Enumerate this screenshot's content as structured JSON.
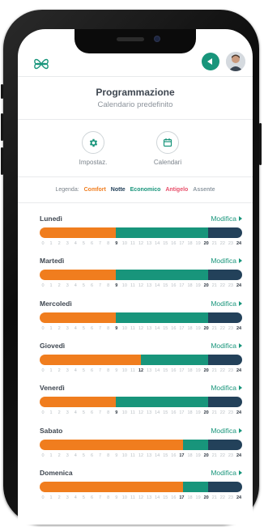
{
  "header": {
    "title": "Programmazione",
    "subtitle": "Calendario predefinito"
  },
  "actions": [
    {
      "label": "Impostaz.",
      "icon": "gear-icon"
    },
    {
      "label": "Calendari",
      "icon": "calendar-icon"
    }
  ],
  "legend": {
    "label": "Legenda:",
    "items": [
      {
        "name": "Comfort",
        "color": "#f07d1e"
      },
      {
        "name": "Notte",
        "color": "#23415a"
      },
      {
        "name": "Economico",
        "color": "#18957b"
      },
      {
        "name": "Antigelo",
        "color": "#e8506b"
      },
      {
        "name": "Assente",
        "color": "#8f9aa3"
      }
    ]
  },
  "colors": {
    "comfort": "#f07d1e",
    "economico": "#18957b",
    "notte": "#23415a",
    "accent": "#18957b"
  },
  "modify_label": "Modifica",
  "hours": [
    "0",
    "1",
    "2",
    "3",
    "4",
    "5",
    "6",
    "7",
    "8",
    "9",
    "10",
    "11",
    "12",
    "13",
    "14",
    "15",
    "16",
    "17",
    "18",
    "19",
    "20",
    "21",
    "22",
    "23",
    "24"
  ],
  "days": [
    {
      "name": "Lunedì",
      "segments": [
        {
          "mode": "comfort",
          "from": 0,
          "to": 9
        },
        {
          "mode": "economico",
          "from": 9,
          "to": 20
        },
        {
          "mode": "notte",
          "from": 20,
          "to": 24
        }
      ],
      "highlight": [
        9,
        20,
        24
      ]
    },
    {
      "name": "Martedì",
      "segments": [
        {
          "mode": "comfort",
          "from": 0,
          "to": 9
        },
        {
          "mode": "economico",
          "from": 9,
          "to": 20
        },
        {
          "mode": "notte",
          "from": 20,
          "to": 24
        }
      ],
      "highlight": [
        9,
        20,
        24
      ]
    },
    {
      "name": "Mercoledì",
      "segments": [
        {
          "mode": "comfort",
          "from": 0,
          "to": 9
        },
        {
          "mode": "economico",
          "from": 9,
          "to": 20
        },
        {
          "mode": "notte",
          "from": 20,
          "to": 24
        }
      ],
      "highlight": [
        9,
        20,
        24
      ]
    },
    {
      "name": "Giovedì",
      "segments": [
        {
          "mode": "comfort",
          "from": 0,
          "to": 12
        },
        {
          "mode": "economico",
          "from": 12,
          "to": 20
        },
        {
          "mode": "notte",
          "from": 20,
          "to": 24
        }
      ],
      "highlight": [
        12,
        20,
        24
      ]
    },
    {
      "name": "Venerdì",
      "segments": [
        {
          "mode": "comfort",
          "from": 0,
          "to": 9
        },
        {
          "mode": "economico",
          "from": 9,
          "to": 20
        },
        {
          "mode": "notte",
          "from": 20,
          "to": 24
        }
      ],
      "highlight": [
        9,
        20,
        24
      ]
    },
    {
      "name": "Sabato",
      "segments": [
        {
          "mode": "comfort",
          "from": 0,
          "to": 17
        },
        {
          "mode": "economico",
          "from": 17,
          "to": 20
        },
        {
          "mode": "notte",
          "from": 20,
          "to": 24
        }
      ],
      "highlight": [
        17,
        20,
        24
      ]
    },
    {
      "name": "Domenica",
      "segments": [
        {
          "mode": "comfort",
          "from": 0,
          "to": 17
        },
        {
          "mode": "economico",
          "from": 17,
          "to": 20
        },
        {
          "mode": "notte",
          "from": 20,
          "to": 24
        }
      ],
      "highlight": [
        17,
        20,
        24
      ]
    }
  ]
}
